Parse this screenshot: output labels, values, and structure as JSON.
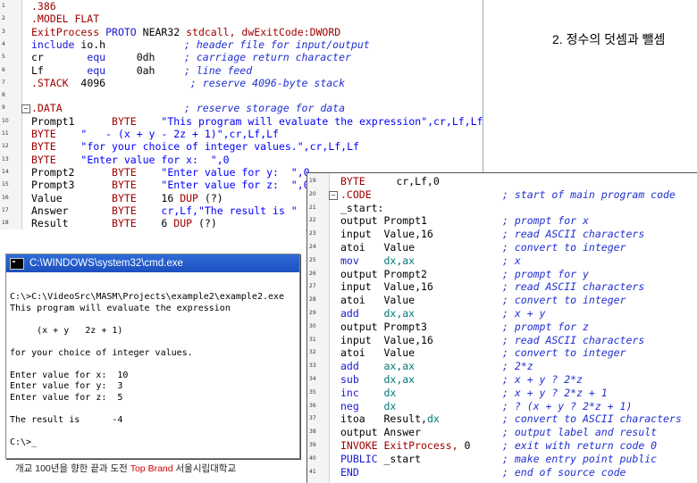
{
  "slide_title": "2. 정수의 덧셈과 뺄셈",
  "editor_top": {
    "lines": [
      {
        "n": "1",
        "parts": [
          {
            "t": ".386",
            "c": "kw"
          }
        ]
      },
      {
        "n": "2",
        "parts": [
          {
            "t": ".MODEL FLAT",
            "c": "kw"
          }
        ]
      },
      {
        "n": "3",
        "parts": [
          {
            "t": "ExitProcess ",
            "c": "kw"
          },
          {
            "t": "PROTO ",
            "c": "blue"
          },
          {
            "t": "NEAR32 ",
            "c": "plain"
          },
          {
            "t": "stdcall, ",
            "c": "kw"
          },
          {
            "t": "dwExitCode:DWORD",
            "c": "kw"
          }
        ]
      },
      {
        "n": "4",
        "parts": [
          {
            "t": "include ",
            "c": "blue"
          },
          {
            "t": "io.h",
            "c": "plain"
          }
        ],
        "cmt": "; header file for input/output"
      },
      {
        "n": "5",
        "parts": [
          {
            "t": "cr       ",
            "c": "plain"
          },
          {
            "t": "equ     ",
            "c": "blue"
          },
          {
            "t": "0dh",
            "c": "plain"
          }
        ],
        "cmt": "; carriage return character"
      },
      {
        "n": "6",
        "parts": [
          {
            "t": "Lf       ",
            "c": "plain"
          },
          {
            "t": "equ     ",
            "c": "blue"
          },
          {
            "t": "0ah",
            "c": "plain"
          }
        ],
        "cmt": "; line feed"
      },
      {
        "n": "7",
        "parts": [
          {
            "t": ".STACK  ",
            "c": "kw"
          },
          {
            "t": "4096",
            "c": "plain"
          }
        ],
        "cmt": " ; reserve 4096-byte stack"
      },
      {
        "n": "8",
        "parts": []
      },
      {
        "n": "9",
        "parts": [
          {
            "t": ".DATA",
            "c": "kw"
          }
        ],
        "cmt": "; reserve storage for data",
        "fold": true
      },
      {
        "n": "10",
        "parts": [
          {
            "t": "Prompt1      ",
            "c": "plain"
          },
          {
            "t": "BYTE    ",
            "c": "kw"
          },
          {
            "t": "\"This program will evaluate the expression\",cr,Lf,Lf",
            "c": "dir"
          }
        ]
      },
      {
        "n": "11",
        "parts": [
          {
            "t": "BYTE    ",
            "c": "kw"
          },
          {
            "t": "\"   - (x + y - 2z + 1)\",cr,Lf,Lf",
            "c": "dir"
          }
        ]
      },
      {
        "n": "12",
        "parts": [
          {
            "t": "BYTE    ",
            "c": "kw"
          },
          {
            "t": "\"for your choice of integer values.\",cr,Lf,Lf",
            "c": "dir"
          }
        ]
      },
      {
        "n": "13",
        "parts": [
          {
            "t": "BYTE    ",
            "c": "kw"
          },
          {
            "t": "\"Enter value for x:  \",0",
            "c": "dir"
          }
        ]
      },
      {
        "n": "14",
        "parts": [
          {
            "t": "Prompt2      ",
            "c": "plain"
          },
          {
            "t": "BYTE    ",
            "c": "kw"
          },
          {
            "t": "\"Enter value for y:  \",0",
            "c": "dir"
          }
        ]
      },
      {
        "n": "15",
        "parts": [
          {
            "t": "Prompt3      ",
            "c": "plain"
          },
          {
            "t": "BYTE    ",
            "c": "kw"
          },
          {
            "t": "\"Enter value for z:  \",0",
            "c": "dir"
          }
        ]
      },
      {
        "n": "16",
        "parts": [
          {
            "t": "Value        ",
            "c": "plain"
          },
          {
            "t": "BYTE    ",
            "c": "kw"
          },
          {
            "t": "16 ",
            "c": "plain"
          },
          {
            "t": "DUP ",
            "c": "kw"
          },
          {
            "t": "(?)",
            "c": "plain"
          }
        ]
      },
      {
        "n": "17",
        "parts": [
          {
            "t": "Answer       ",
            "c": "plain"
          },
          {
            "t": "BYTE    ",
            "c": "kw"
          },
          {
            "t": "cr,Lf,\"The result is \"",
            "c": "dir"
          }
        ]
      },
      {
        "n": "18",
        "parts": [
          {
            "t": "Result       ",
            "c": "plain"
          },
          {
            "t": "BYTE    ",
            "c": "kw"
          },
          {
            "t": "6 ",
            "c": "plain"
          },
          {
            "t": "DUP ",
            "c": "kw"
          },
          {
            "t": "(?)",
            "c": "plain"
          }
        ]
      }
    ]
  },
  "editor_bottom": {
    "lines": [
      {
        "n": "19",
        "parts": [
          {
            "t": "BYTE     ",
            "c": "kw"
          },
          {
            "t": "cr,Lf,0",
            "c": "plain"
          }
        ]
      },
      {
        "n": "20",
        "parts": [
          {
            "t": ".CODE",
            "c": "kw"
          }
        ],
        "cmt": "; start of main program code",
        "fold": true
      },
      {
        "n": "21",
        "parts": [
          {
            "t": "_start:",
            "c": "plain"
          }
        ]
      },
      {
        "n": "22",
        "parts": [
          {
            "t": "output ",
            "c": "plain"
          },
          {
            "t": "Prompt1",
            "c": "plain"
          }
        ],
        "cmt": "; prompt for x"
      },
      {
        "n": "23",
        "parts": [
          {
            "t": "input  ",
            "c": "plain"
          },
          {
            "t": "Value,16",
            "c": "plain"
          }
        ],
        "cmt": "; read ASCII characters"
      },
      {
        "n": "24",
        "parts": [
          {
            "t": "atoi   ",
            "c": "plain"
          },
          {
            "t": "Value",
            "c": "plain"
          }
        ],
        "cmt": "; convert to integer"
      },
      {
        "n": "25",
        "parts": [
          {
            "t": "mov    ",
            "c": "blue"
          },
          {
            "t": "dx,ax",
            "c": "green"
          }
        ],
        "cmt": "; x"
      },
      {
        "n": "26",
        "parts": [
          {
            "t": "output ",
            "c": "plain"
          },
          {
            "t": "Prompt2",
            "c": "plain"
          }
        ],
        "cmt": "; prompt for y"
      },
      {
        "n": "27",
        "parts": [
          {
            "t": "input  ",
            "c": "plain"
          },
          {
            "t": "Value,16",
            "c": "plain"
          }
        ],
        "cmt": "; read ASCII characters"
      },
      {
        "n": "28",
        "parts": [
          {
            "t": "atoi   ",
            "c": "plain"
          },
          {
            "t": "Value",
            "c": "plain"
          }
        ],
        "cmt": "; convert to integer"
      },
      {
        "n": "29",
        "parts": [
          {
            "t": "add    ",
            "c": "blue"
          },
          {
            "t": "dx,ax",
            "c": "green"
          }
        ],
        "cmt": "; x + y"
      },
      {
        "n": "30",
        "parts": [
          {
            "t": "output ",
            "c": "plain"
          },
          {
            "t": "Prompt3",
            "c": "plain"
          }
        ],
        "cmt": "; prompt for z"
      },
      {
        "n": "31",
        "parts": [
          {
            "t": "input  ",
            "c": "plain"
          },
          {
            "t": "Value,16",
            "c": "plain"
          }
        ],
        "cmt": "; read ASCII characters"
      },
      {
        "n": "32",
        "parts": [
          {
            "t": "atoi   ",
            "c": "plain"
          },
          {
            "t": "Value",
            "c": "plain"
          }
        ],
        "cmt": "; convert to integer"
      },
      {
        "n": "33",
        "parts": [
          {
            "t": "add    ",
            "c": "blue"
          },
          {
            "t": "ax,ax",
            "c": "green"
          }
        ],
        "cmt": "; 2*z"
      },
      {
        "n": "34",
        "parts": [
          {
            "t": "sub    ",
            "c": "blue"
          },
          {
            "t": "dx,ax",
            "c": "green"
          }
        ],
        "cmt": "; x + y ? 2*z"
      },
      {
        "n": "35",
        "parts": [
          {
            "t": "inc    ",
            "c": "blue"
          },
          {
            "t": "dx",
            "c": "green"
          }
        ],
        "cmt": "; x + y ? 2*z + 1"
      },
      {
        "n": "36",
        "parts": [
          {
            "t": "neg    ",
            "c": "blue"
          },
          {
            "t": "dx",
            "c": "green"
          }
        ],
        "cmt": "; ? (x + y ? 2*z + 1)"
      },
      {
        "n": "37",
        "parts": [
          {
            "t": "itoa   ",
            "c": "plain"
          },
          {
            "t": "Result,",
            "c": "plain"
          },
          {
            "t": "dx",
            "c": "green"
          }
        ],
        "cmt": "; convert to ASCII characters"
      },
      {
        "n": "38",
        "parts": [
          {
            "t": "output ",
            "c": "plain"
          },
          {
            "t": "Answer",
            "c": "plain"
          }
        ],
        "cmt": "; output label and result"
      },
      {
        "n": "39",
        "parts": [
          {
            "t": "INVOKE ",
            "c": "kw"
          },
          {
            "t": "ExitProcess, ",
            "c": "kw"
          },
          {
            "t": "0",
            "c": "plain"
          }
        ],
        "cmt": "; exit with return code 0"
      },
      {
        "n": "40",
        "parts": [
          {
            "t": "PUBLIC ",
            "c": "blue"
          },
          {
            "t": "_start",
            "c": "plain"
          }
        ],
        "cmt": "; make entry point public"
      },
      {
        "n": "41",
        "parts": [
          {
            "t": "END",
            "c": "blue"
          }
        ],
        "cmt": "; end of source code"
      }
    ]
  },
  "console": {
    "title": "C:\\WINDOWS\\system32\\cmd.exe",
    "lines": [
      "C:\\>C:\\VideoSrc\\MASM\\Projects\\example2\\example2.exe",
      "This program will evaluate the expression",
      "",
      "     (x + y   2z + 1)",
      "",
      "for your choice of integer values.",
      "",
      "Enter value for x:  10",
      "Enter value for y:  3",
      "Enter value for z:  5",
      "",
      "The result is      -4",
      "",
      "C:\\>_"
    ]
  },
  "footer": {
    "prefix": "개교 100년을 향한 끝과 도전 ",
    "brand": "Top Brand",
    "suffix": " 서울시립대학교"
  },
  "colors": {
    "keyword": "#a00000",
    "directive": "#0000ff",
    "comment": "#2030d0",
    "register": "#007777",
    "cmd_titlebar": "#1d4fbf"
  }
}
